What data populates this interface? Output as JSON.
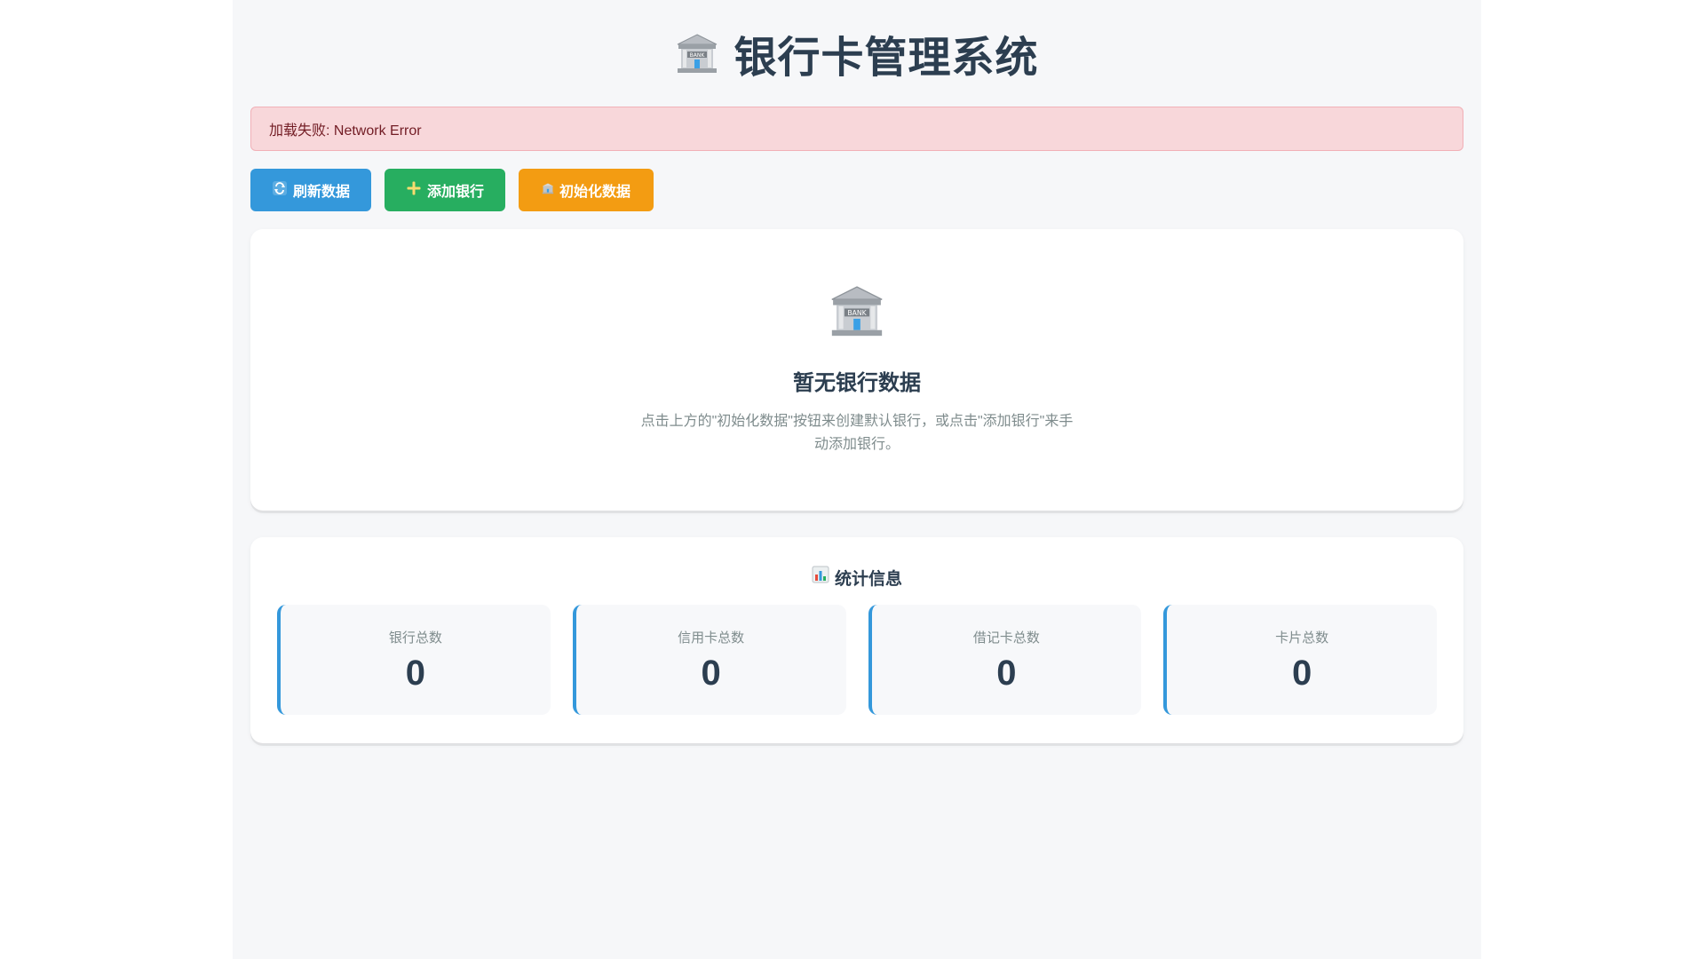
{
  "header": {
    "title": "银行卡管理系统",
    "icon": "bank-icon"
  },
  "alert": {
    "message": "加载失败: Network Error",
    "type": "error"
  },
  "toolbar": {
    "refresh_label": "刷新数据",
    "refresh_icon": "refresh-icon",
    "add_label": "添加银行",
    "add_icon": "plus-icon",
    "init_label": "初始化数据",
    "init_icon": "bank-icon"
  },
  "empty_state": {
    "icon": "bank-icon",
    "title": "暂无银行数据",
    "description": "点击上方的\"初始化数据\"按钮来创建默认银行，或点击\"添加银行\"来手动添加银行。"
  },
  "stats": {
    "title": "统计信息",
    "icon": "bar-chart-icon",
    "items": [
      {
        "label": "银行总数",
        "value": "0"
      },
      {
        "label": "信用卡总数",
        "value": "0"
      },
      {
        "label": "借记卡总数",
        "value": "0"
      },
      {
        "label": "卡片总数",
        "value": "0"
      }
    ]
  },
  "colors": {
    "primary": "#3498db",
    "success": "#27ae60",
    "warning": "#f39c12",
    "error_bg": "#f8d7da",
    "error_text": "#721c24",
    "heading": "#2c3e50"
  }
}
